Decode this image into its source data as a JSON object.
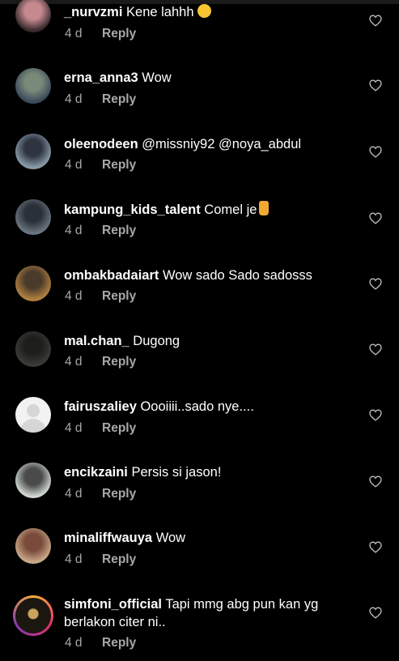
{
  "comments": [
    {
      "username": "_nurvzmi",
      "text": "Kene lahhh",
      "emoji": "grinning-emoji",
      "time": "4 d",
      "reply_label": "Reply",
      "avatar_colors": [
        "#3a2a2e",
        "#c58a90"
      ]
    },
    {
      "username": "erna_anna3",
      "text": "Wow",
      "time": "4 d",
      "reply_label": "Reply",
      "avatar_colors": [
        "#3c4a5a",
        "#7a8a7a"
      ]
    },
    {
      "username": "oleenodeen",
      "text": "@missniy92 @noya_abdul",
      "time": "4 d",
      "reply_label": "Reply",
      "avatar_colors": [
        "#8a9aa8",
        "#2e3440"
      ]
    },
    {
      "username": "kampung_kids_talent",
      "text": "Comel je",
      "emoji": "thumbs-up-emoji",
      "time": "4 d",
      "reply_label": "Reply",
      "avatar_colors": [
        "#6a7580",
        "#2a3038"
      ]
    },
    {
      "username": "ombakbadaiart",
      "text": "Wow sado Sado sadosss",
      "time": "4 d",
      "reply_label": "Reply",
      "avatar_colors": [
        "#b08040",
        "#4a3a2a"
      ]
    },
    {
      "username": "mal.chan_",
      "text": "Dugong",
      "time": "4 d",
      "reply_label": "Reply",
      "avatar_colors": [
        "#3a3a36",
        "#1e1e1c"
      ]
    },
    {
      "username": "fairuszaliey",
      "text": "Oooiiii..sado nye....",
      "time": "4 d",
      "reply_label": "Reply",
      "avatar_colors": [
        "#f2f2f2",
        "#d6d6d6"
      ]
    },
    {
      "username": "encikzaini",
      "text": "Persis si jason!",
      "time": "4 d",
      "reply_label": "Reply",
      "avatar_colors": [
        "#cfd8d0",
        "#4a4a4a"
      ]
    },
    {
      "username": "minaliffwauya",
      "text": "Wow",
      "time": "4 d",
      "reply_label": "Reply",
      "avatar_colors": [
        "#c8a888",
        "#7a4a3a"
      ]
    },
    {
      "username": "simfoni_official",
      "text": "Tapi mmg abg pun kan yg berlakon citer ni..",
      "time": "4 d",
      "reply_label": "Reply",
      "avatar_colors": [
        "#1b1610",
        "#c9a45a"
      ]
    }
  ],
  "icons": {
    "like": "heart-outline-icon"
  },
  "colors": {
    "background": "#000000",
    "meta": "#a8a8a8"
  }
}
